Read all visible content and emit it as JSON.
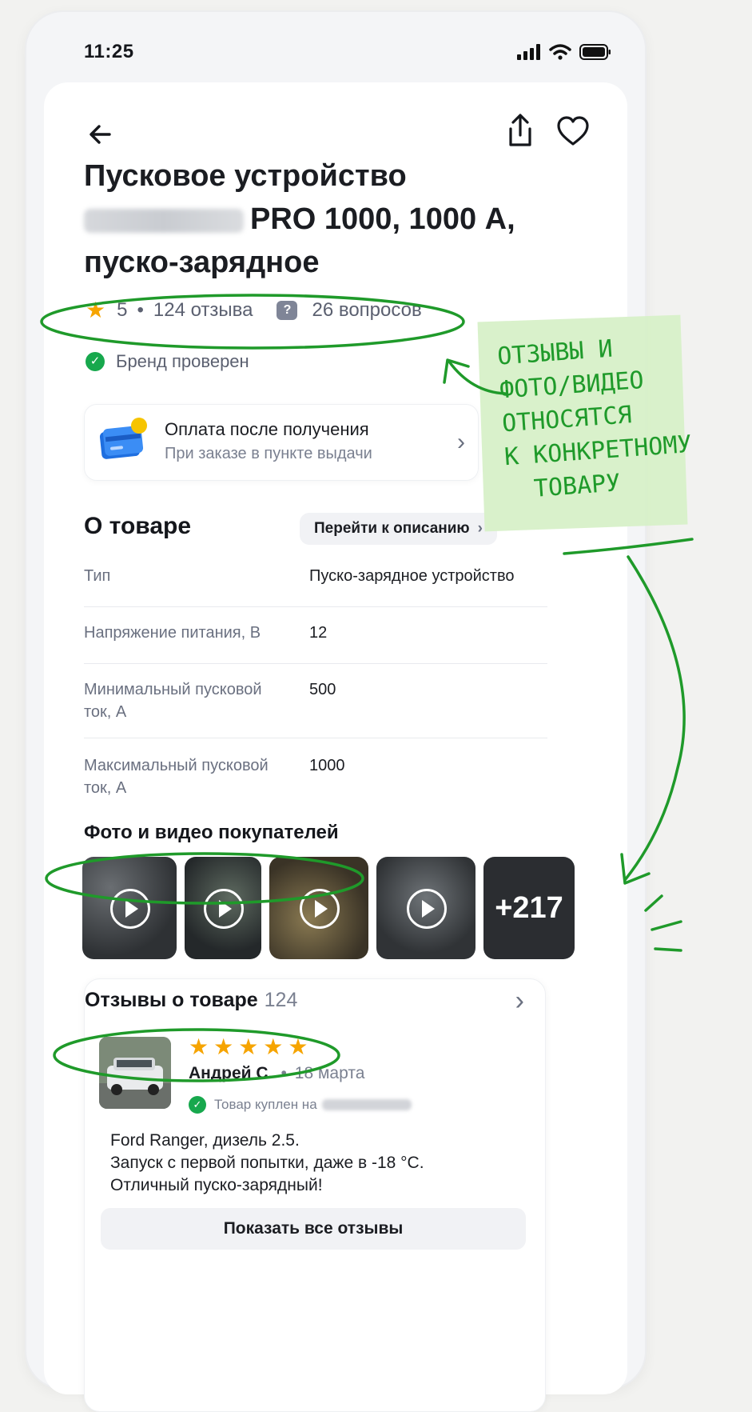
{
  "status_bar": {
    "time": "11:25"
  },
  "product": {
    "title_line1": "Пусковое устройство",
    "title_line2": "PRO 1000, 1000 А,",
    "title_line3": "пуско-зарядное",
    "rating": "5",
    "reviews_label": "124 отзыва",
    "questions_label": "26 вопросов",
    "brand_verified": "Бренд проверен"
  },
  "payment": {
    "title": "Оплата после получения",
    "subtitle": "При заказе в пункте выдачи"
  },
  "about": {
    "heading": "О товаре",
    "goto_label": "Перейти к описанию",
    "specs": [
      {
        "label": "Тип",
        "value": "Пуско-зарядное устройство"
      },
      {
        "label": "Напряжение питания, В",
        "value": "12"
      },
      {
        "label": "Минимальный пусковой ток, А",
        "value": "500"
      },
      {
        "label": "Максимальный пусковой ток, А",
        "value": "1000"
      }
    ]
  },
  "media": {
    "heading": "Фото и видео покупателей",
    "more_label": "+217"
  },
  "reviews": {
    "heading": "Отзывы о товаре",
    "count": "124",
    "author": "Андрей С.",
    "date": "18 марта",
    "bought_label": "Товар куплен на",
    "rating_stars": 5,
    "text_line1": "Ford Ranger, дизель 2.5.",
    "text_line2": "Запуск с первой попытки, даже в -18 °C.",
    "text_line3": "Отличный пуско-зарядный!",
    "show_all_label": "Показать все отзывы"
  },
  "annotation": {
    "line1": "ОТЗЫВЫ И",
    "line2": "ФОТО/ВИДЕО",
    "line3": "ОТНОСЯТСЯ",
    "line4": "К КОНКРЕТНОМУ",
    "line5": "ТОВАРУ",
    "color": "#1f9a2a"
  },
  "colors": {
    "star": "#f6a400",
    "verified": "#17a84d",
    "accent_green": "#1f9a2a"
  }
}
